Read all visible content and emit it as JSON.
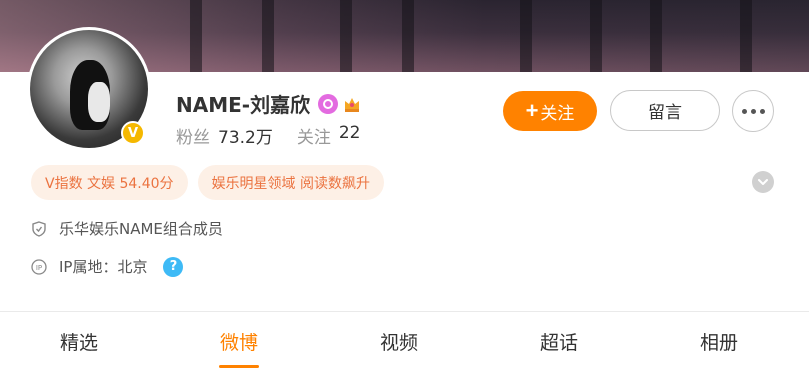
{
  "profile": {
    "name": "NAME-刘嘉欣",
    "verified_mark": "V",
    "badges": [
      "svip-icon",
      "crown-icon"
    ],
    "stats": [
      {
        "label": "粉丝",
        "value": "73.2万"
      },
      {
        "label": "关注",
        "value": "22"
      }
    ]
  },
  "actions": {
    "follow_label": "关注",
    "message_label": "留言",
    "more_icon": "more-dots-icon"
  },
  "tags": [
    "V指数 文娱 54.40分",
    "娱乐明星领域 阅读数飙升"
  ],
  "info": {
    "description": "乐华娱乐NAME组合成员",
    "ip_location": "IP属地：北京",
    "help_mark": "?"
  },
  "tabs": [
    {
      "label": "精选",
      "active": false
    },
    {
      "label": "微博",
      "active": true
    },
    {
      "label": "视频",
      "active": false
    },
    {
      "label": "超话",
      "active": false
    },
    {
      "label": "相册",
      "active": false
    }
  ],
  "colors": {
    "accent": "#ff8200",
    "tag_bg": "#fdf0e6",
    "tag_text": "#eb7340",
    "verified": "#f5b800",
    "help": "#3ebaf6"
  }
}
